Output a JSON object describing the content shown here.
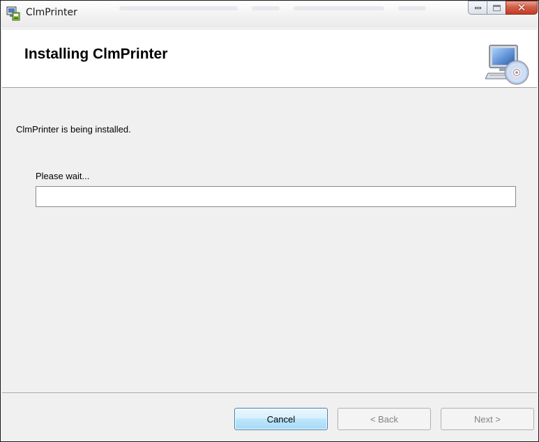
{
  "window": {
    "title": "ClmPrinter",
    "app_icon": "installer-icon",
    "minimize_icon": "minimize-icon",
    "maximize_icon": "maximize-icon",
    "close_icon": "close-icon"
  },
  "banner": {
    "title": "Installing ClmPrinter",
    "icon": "computer-cd-icon"
  },
  "body": {
    "status": "ClmPrinter is being installed.",
    "wait_label": "Please wait...",
    "progress_percent": 0
  },
  "buttons": {
    "cancel": "Cancel",
    "back": "< Back",
    "next": "Next >"
  },
  "colors": {
    "close_button": "#c74a32",
    "default_button_border": "#3c7fb1"
  }
}
